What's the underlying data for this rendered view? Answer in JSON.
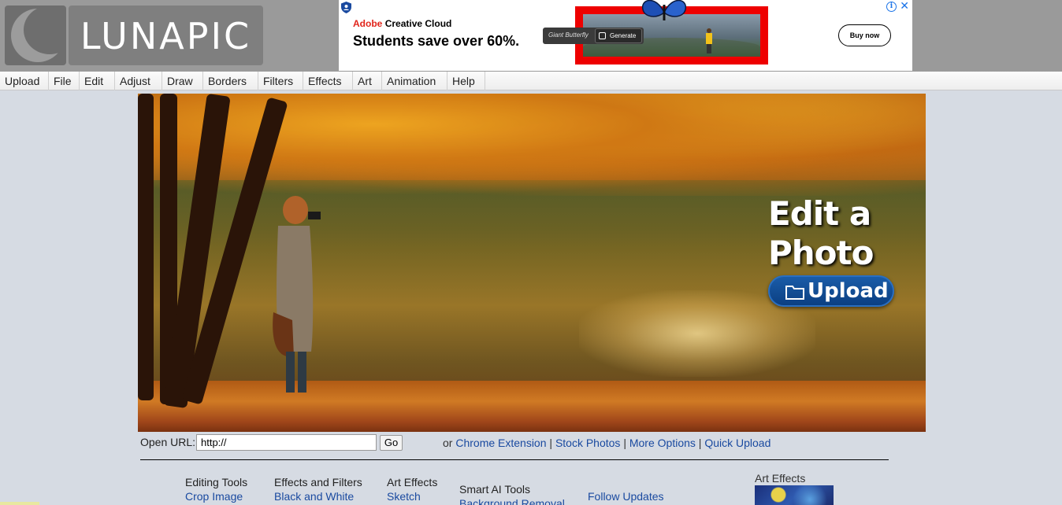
{
  "logo": {
    "text": "LUNAPIC"
  },
  "ad": {
    "brand_adobe": "Adobe",
    "brand_product": "Creative Cloud",
    "headline": "Students save over 60%.",
    "prompt_text": "Giant Butterfly",
    "generate_label": "Generate",
    "buy_label": "Buy now",
    "info_icon": "info-icon",
    "close_icon": "close-icon"
  },
  "menu": {
    "items": [
      "Upload",
      "File",
      "Edit",
      "Adjust",
      "Draw",
      "Borders",
      "Filters",
      "Effects",
      "Art",
      "Animation",
      "Help"
    ]
  },
  "hero": {
    "title_line1": "Edit a",
    "title_line2": "Photo",
    "upload_label": "Upload",
    "upload_icon": "folder-icon"
  },
  "url_row": {
    "label": "Open URL:",
    "input_value": "http://",
    "go_label": "Go",
    "or_text": "or",
    "links": [
      "Chrome Extension",
      "Stock Photos",
      "More Options",
      "Quick Upload"
    ],
    "separator": "|"
  },
  "columns": [
    {
      "head": "Editing Tools",
      "link": "Crop Image"
    },
    {
      "head": "Effects and Filters",
      "link": "Black and White"
    },
    {
      "head": "Art Effects",
      "link": "Sketch"
    },
    {
      "head": "Smart AI Tools",
      "link": "Background Removal"
    },
    {
      "head": "",
      "link": "Follow Updates"
    }
  ],
  "art_effects": {
    "title": "Art Effects"
  },
  "colors": {
    "link": "#1a4aa0",
    "header_bg": "#9a9a9a",
    "page_bg": "#d6dbe3",
    "upload_button": "#0b3f82",
    "adobe_red": "#e1251b"
  }
}
